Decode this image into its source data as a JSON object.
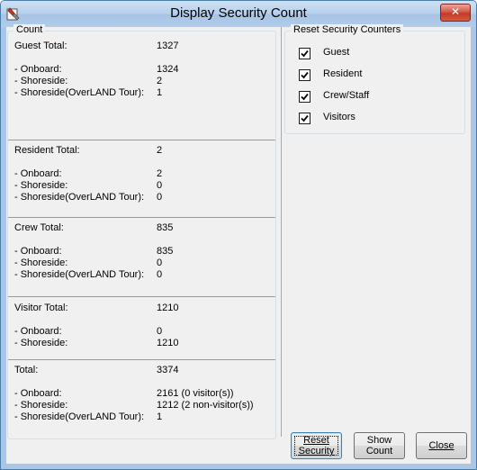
{
  "window": {
    "title": "Display Security Count",
    "close_glyph": "✕"
  },
  "count": {
    "legend": "Count",
    "guest": {
      "total_label": "Guest Total:",
      "total": "1327",
      "onboard_label": "- Onboard:",
      "onboard": "1324",
      "shoreside_label": "- Shoreside:",
      "shoreside": "2",
      "tour_label": "- Shoreside(OverLAND Tour):",
      "tour": "1"
    },
    "resident": {
      "total_label": "Resident Total:",
      "total": "2",
      "onboard_label": "- Onboard:",
      "onboard": "2",
      "shoreside_label": "- Shoreside:",
      "shoreside": "0",
      "tour_label": "- Shoreside(OverLAND Tour):",
      "tour": "0"
    },
    "crew": {
      "total_label": "Crew Total:",
      "total": "835",
      "onboard_label": "- Onboard:",
      "onboard": "835",
      "shoreside_label": "- Shoreside:",
      "shoreside": "0",
      "tour_label": "- Shoreside(OverLAND Tour):",
      "tour": "0"
    },
    "visitor": {
      "total_label": "Visitor Total:",
      "total": "1210",
      "onboard_label": "- Onboard:",
      "onboard": "0",
      "shoreside_label": "- Shoreside:",
      "shoreside": "1210"
    },
    "overall": {
      "total_label": "Total:",
      "total": "3374",
      "onboard_label": "- Onboard:",
      "onboard": "2161 (0 visitor(s))",
      "shoreside_label": "- Shoreside:",
      "shoreside": "1212 (2 non-visitor(s))",
      "tour_label": "- Shoreside(OverLAND Tour):",
      "tour": "1"
    }
  },
  "reset_counters": {
    "legend": "Reset Security Counters",
    "items": [
      {
        "label": "Guest",
        "checked": true
      },
      {
        "label": "Resident",
        "checked": true
      },
      {
        "label": "Crew/Staff",
        "checked": true
      },
      {
        "label": "Visitors",
        "checked": true
      }
    ]
  },
  "buttons": {
    "reset_security": {
      "line1": "Reset",
      "line2": "Security"
    },
    "show_count": {
      "line1": "Show",
      "line2": "Count"
    },
    "close": {
      "label": "Close"
    }
  }
}
